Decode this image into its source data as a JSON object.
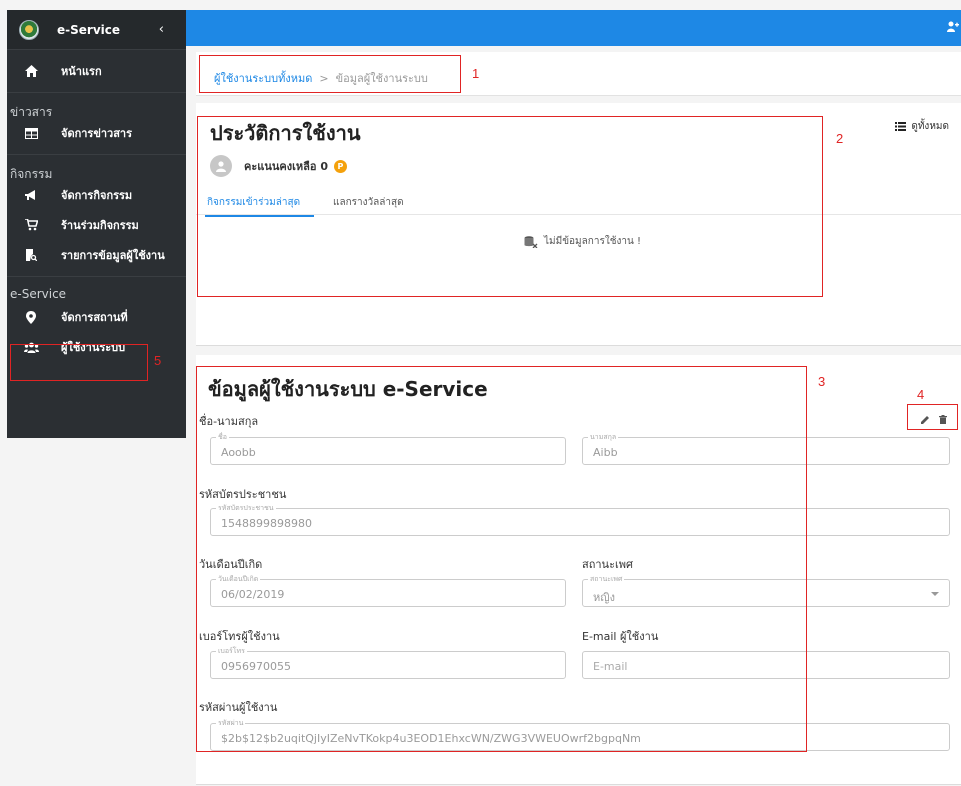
{
  "sidebar": {
    "brand": "e-Service",
    "collapse_icon": "‹",
    "home_label": "หน้าแรก",
    "sections": [
      {
        "title": "ข่าวสาร",
        "items": [
          {
            "label": "จัดการข่าวสาร",
            "icon": "newspaper-icon"
          }
        ]
      },
      {
        "title": "กิจกรรม",
        "items": [
          {
            "label": "จัดการกิจกรรม",
            "icon": "megaphone-icon"
          },
          {
            "label": "ร้านร่วมกิจกรรม",
            "icon": "cart-icon"
          },
          {
            "label": "รายการข้อมูลผู้ใช้งาน",
            "icon": "receipt-search-icon"
          }
        ]
      },
      {
        "title": "e-Service",
        "items": [
          {
            "label": "จัดการสถานที่",
            "icon": "map-marker-icon"
          },
          {
            "label": "ผู้ใช้งานระบบ",
            "icon": "users-icon"
          }
        ]
      }
    ]
  },
  "breadcrumb": {
    "link": "ผู้ใช้งานระบบทั้งหมด",
    "separator": ">",
    "current": "ข้อมูลผู้ใช้งานระบบ"
  },
  "history": {
    "title": "ประวัติการใช้งาน",
    "view_all": "ดูทั้งหมด",
    "points_label": "คะแนนคงเหลือ 0",
    "coin_letter": "P",
    "tabs": [
      "กิจกรรมเข้าร่วมล่าสุด",
      "แลกรางวัลล่าสุด"
    ],
    "empty_text": "ไม่มีข้อมูลการใช้งาน !"
  },
  "user_info": {
    "title": "ข้อมูลผู้ใช้งานระบบ e-Service",
    "name_section": "ชื่อ-นามสกุล",
    "first_name": {
      "label": "ชื่อ",
      "value": "Aoobb"
    },
    "last_name": {
      "label": "นามสกุล",
      "value": "Aibb"
    },
    "id_section": "รหัสบัตรประชาชน",
    "id_card": {
      "label": "รหัสบัตรประชาชน",
      "value": "1548899898980"
    },
    "birth_section": "วันเดือนปีเกิด",
    "birth": {
      "label": "วันเดือนปีเกิด",
      "value": "06/02/2019"
    },
    "gender_section": "สถานะเพศ",
    "gender": {
      "label": "สถานะเพศ",
      "value": "หญิง"
    },
    "phone_section": "เบอร์โทรผู้ใช้งาน",
    "phone": {
      "label": "เบอร์โทร",
      "value": "0956970055"
    },
    "email_section": "E-mail ผู้ใช้งาน",
    "email": {
      "placeholder": "E-mail"
    },
    "password_section": "รหัสผ่านผู้ใช้งาน",
    "password": {
      "label": "รหัสผ่าน",
      "value": "$2b$12$b2uqitQjIyIZeNvTKokp4u3EOD1EhxcWN/ZWG3VWEUOwrf2bgpqNm"
    }
  },
  "annotations": [
    "1",
    "2",
    "3",
    "4",
    "5"
  ],
  "colors": {
    "primary": "#1e88e5",
    "sidebar": "#2b2f33",
    "annotation": "#e02424",
    "coin": "#f4a10c"
  }
}
